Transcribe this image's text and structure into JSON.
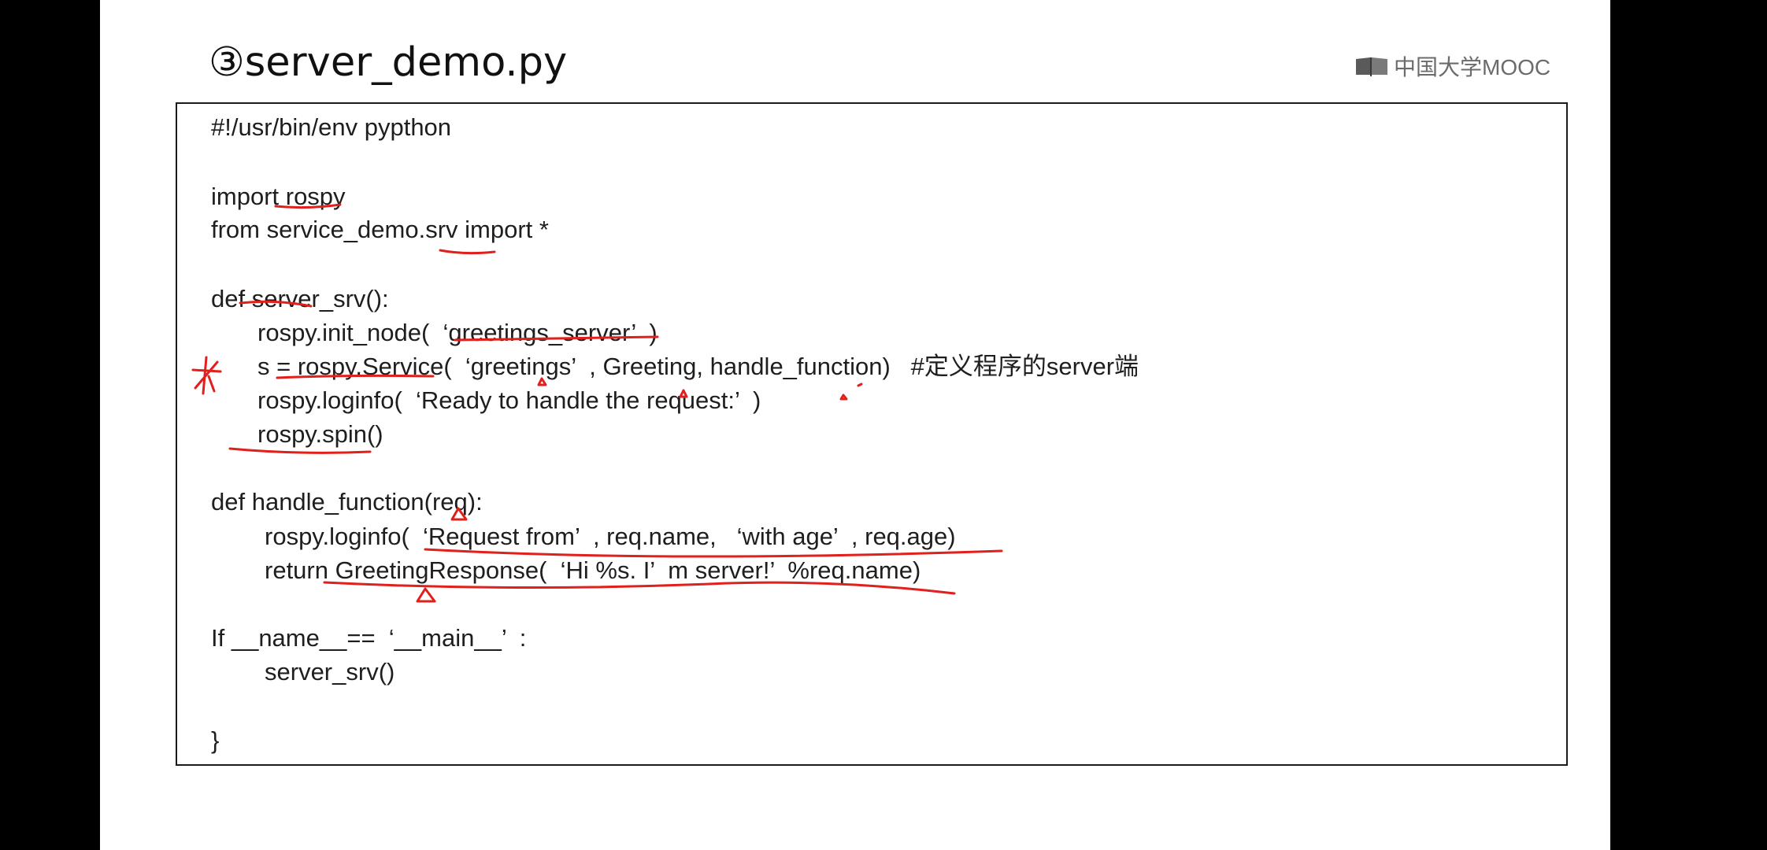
{
  "slide": {
    "title": "③server_demo.py",
    "watermark": "中国大学MOOC"
  },
  "code": {
    "lines": [
      "#!/usr/bin/env pypthon",
      "import rospy",
      "from service_demo.srv import *",
      "def server_srv():",
      "rospy.init_node(  ‘greetings_server’  )",
      "s = rospy.Service(  ‘greetings’  , Greeting, handle_function)   #定义程序的server端",
      "rospy.loginfo(  ‘Ready to handle the request:’  )",
      "rospy.spin()",
      "def handle_function(req):",
      "rospy.loginfo(  ‘Request from’  , req.name,   ‘with age’  , req.age)",
      "return GreetingResponse(  ‘Hi %s. I’  m server!’  %req.name)",
      "If __name__==  ‘__main__’  :",
      "server_srv()",
      "}"
    ]
  },
  "colors": {
    "annotation": "#e0201d",
    "background": "#000000",
    "slide": "#ffffff"
  }
}
